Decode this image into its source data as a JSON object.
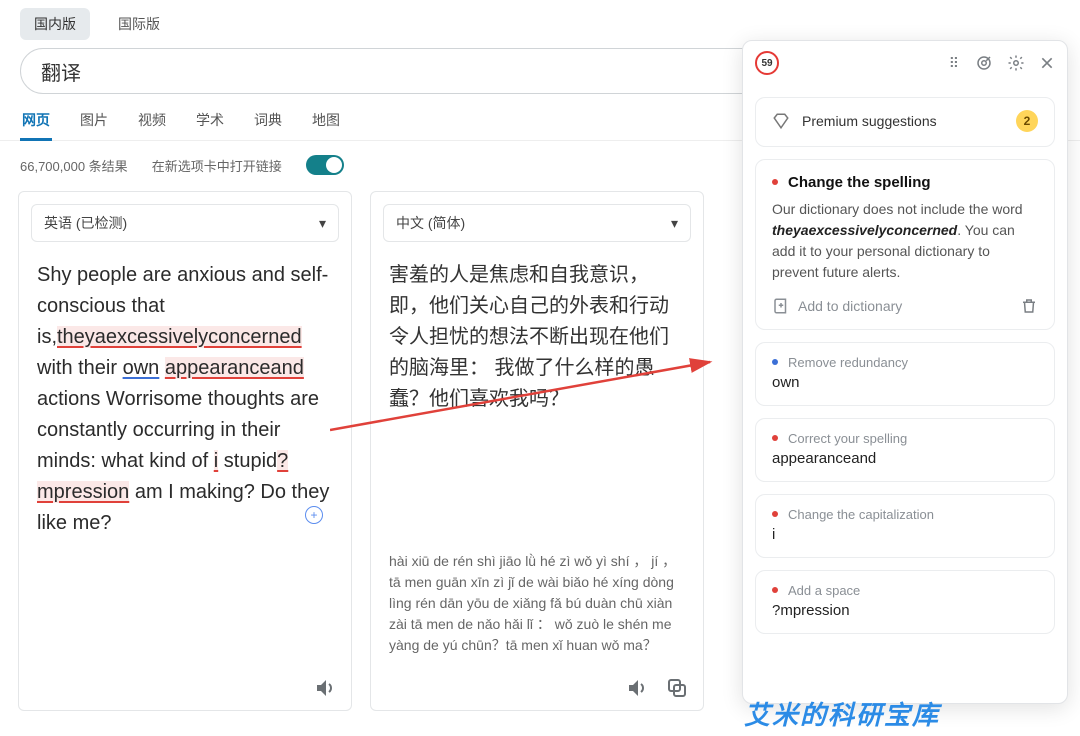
{
  "top_tabs": {
    "domestic": "国内版",
    "international": "国际版"
  },
  "search": {
    "value": "翻译"
  },
  "nav_tabs": [
    "网页",
    "图片",
    "视频",
    "学术",
    "词典",
    "地图"
  ],
  "results_count": "66,700,000 条结果",
  "open_new_tab_label": "在新选项卡中打开链接",
  "lang": {
    "source": "英语 (已检测)",
    "target": "中文 (简体)"
  },
  "source_text": {
    "p1a": "Shy people are anxious and self-conscious that is,",
    "err1": "theyaexcessivelyconcerned",
    "p1b": " with their ",
    "own": "own",
    "p1c": " ",
    "appand": "appearanceand",
    "p1d": " actions Worrisome thoughts are constantly occurring in their minds: what kind of ",
    "i": "i",
    "p1e": " stupid",
    "qmp": "?mpression",
    "p1f": " am I making? Do they like me?"
  },
  "target_text": {
    "l1": "害羞的人是焦虑和自我意识，即，他们关心自己的外表和行动",
    "l2": "令人担忧的想法不断出现在他们的脑海里： 我做了什么样的愚蠢？他们喜欢我吗？"
  },
  "pinyin": "hài xiū de rén shì jiāo lǜ hé zì wǒ yì shí ， jí ， tā men guān xīn zì jǐ de wài biǎo hé xíng dòng\nlìng rén dān yōu de xiǎng fǎ bú duàn chū xiàn zài tā men de nǎo hǎi lǐ ： wǒ zuò le shén me yàng de yú chūn？tā men xǐ huan wǒ ma？",
  "panel": {
    "score": "59",
    "premium_label": "Premium suggestions",
    "premium_count": "2",
    "main": {
      "title": "Change the spelling",
      "desc_a": "Our dictionary does not include the word ",
      "word": "theyaexcessivelyconcerned",
      "desc_b": ". You can add it to your personal dictionary to prevent future alerts.",
      "add_label": "Add to dictionary"
    },
    "suggestions": [
      {
        "color": "blue",
        "title": "Remove redundancy",
        "word": "own"
      },
      {
        "color": "red",
        "title": "Correct your spelling",
        "word": "appearanceand"
      },
      {
        "color": "red",
        "title": "Change the capitalization",
        "word": "i"
      },
      {
        "color": "red",
        "title": "Add a space",
        "word": "?mpression"
      }
    ]
  },
  "watermark": "艾米的科研宝库"
}
